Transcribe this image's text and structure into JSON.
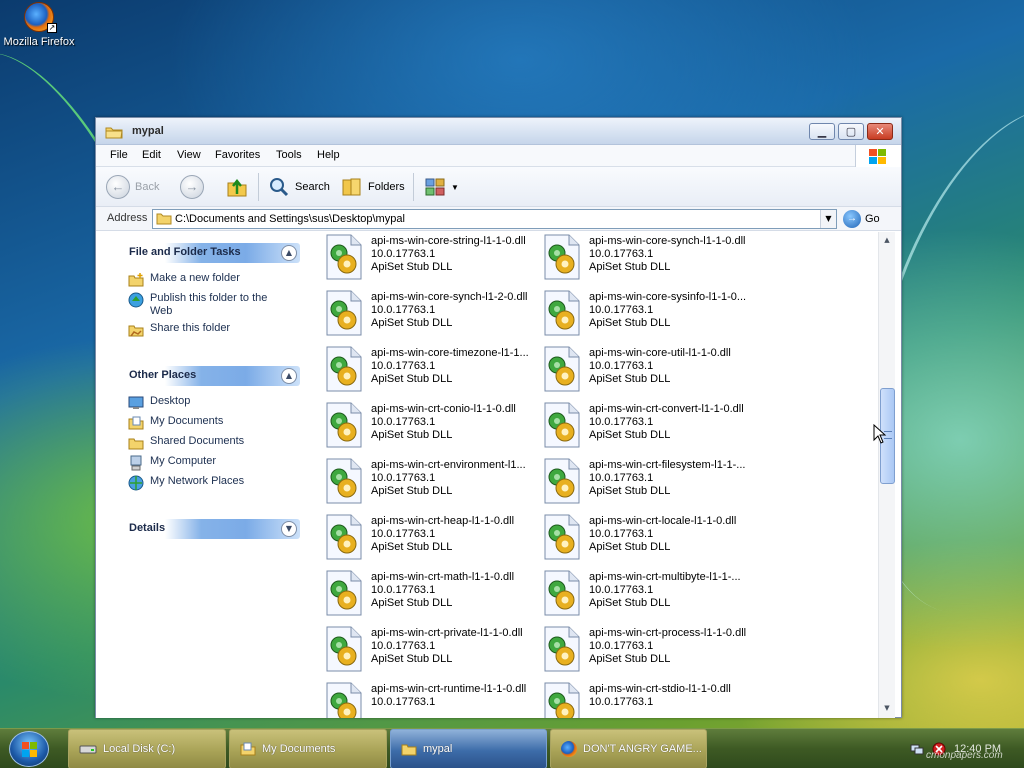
{
  "desktop": {
    "icons": [
      {
        "label": "Mozilla Firefox",
        "icon": "firefox-icon"
      }
    ],
    "watermark": "cmonpapers.com"
  },
  "window": {
    "title": "mypal",
    "controls": {
      "minimize": "minimize",
      "maximize": "maximize",
      "close": "close"
    },
    "menu": [
      "File",
      "Edit",
      "View",
      "Favorites",
      "Tools",
      "Help"
    ],
    "toolbar": {
      "back": "Back",
      "forward": "",
      "search": "Search",
      "folders": "Folders"
    },
    "address": {
      "label": "Address",
      "value": "C:\\Documents and Settings\\sus\\Desktop\\mypal",
      "go": "Go"
    },
    "taskpane": {
      "groups": [
        {
          "title": "File and Folder Tasks",
          "items": [
            {
              "label": "Make a new folder",
              "icon": "new-folder-icon"
            },
            {
              "label": "Publish this folder to the Web",
              "icon": "publish-web-icon"
            },
            {
              "label": "Share this folder",
              "icon": "share-folder-icon"
            }
          ]
        },
        {
          "title": "Other Places",
          "items": [
            {
              "label": "Desktop",
              "icon": "desktop-icon"
            },
            {
              "label": "My Documents",
              "icon": "my-documents-icon"
            },
            {
              "label": "Shared Documents",
              "icon": "shared-documents-icon"
            },
            {
              "label": "My Computer",
              "icon": "my-computer-icon"
            },
            {
              "label": "My Network Places",
              "icon": "network-places-icon"
            }
          ]
        },
        {
          "title": "Details",
          "items": []
        }
      ]
    },
    "files": [
      {
        "name": "api-ms-win-core-string-l1-1-0.dll",
        "version": "10.0.17763.1",
        "description": "ApiSet Stub DLL"
      },
      {
        "name": "api-ms-win-core-synch-l1-1-0.dll",
        "version": "10.0.17763.1",
        "description": "ApiSet Stub DLL"
      },
      {
        "name": "api-ms-win-core-synch-l1-2-0.dll",
        "version": "10.0.17763.1",
        "description": "ApiSet Stub DLL"
      },
      {
        "name": "api-ms-win-core-sysinfo-l1-1-0...",
        "version": "10.0.17763.1",
        "description": "ApiSet Stub DLL"
      },
      {
        "name": "api-ms-win-core-timezone-l1-1...",
        "version": "10.0.17763.1",
        "description": "ApiSet Stub DLL"
      },
      {
        "name": "api-ms-win-core-util-l1-1-0.dll",
        "version": "10.0.17763.1",
        "description": "ApiSet Stub DLL"
      },
      {
        "name": "api-ms-win-crt-conio-l1-1-0.dll",
        "version": "10.0.17763.1",
        "description": "ApiSet Stub DLL"
      },
      {
        "name": "api-ms-win-crt-convert-l1-1-0.dll",
        "version": "10.0.17763.1",
        "description": "ApiSet Stub DLL"
      },
      {
        "name": "api-ms-win-crt-environment-l1...",
        "version": "10.0.17763.1",
        "description": "ApiSet Stub DLL"
      },
      {
        "name": "api-ms-win-crt-filesystem-l1-1-...",
        "version": "10.0.17763.1",
        "description": "ApiSet Stub DLL"
      },
      {
        "name": "api-ms-win-crt-heap-l1-1-0.dll",
        "version": "10.0.17763.1",
        "description": "ApiSet Stub DLL"
      },
      {
        "name": "api-ms-win-crt-locale-l1-1-0.dll",
        "version": "10.0.17763.1",
        "description": "ApiSet Stub DLL"
      },
      {
        "name": "api-ms-win-crt-math-l1-1-0.dll",
        "version": "10.0.17763.1",
        "description": "ApiSet Stub DLL"
      },
      {
        "name": "api-ms-win-crt-multibyte-l1-1-...",
        "version": "10.0.17763.1",
        "description": "ApiSet Stub DLL"
      },
      {
        "name": "api-ms-win-crt-private-l1-1-0.dll",
        "version": "10.0.17763.1",
        "description": "ApiSet Stub DLL"
      },
      {
        "name": "api-ms-win-crt-process-l1-1-0.dll",
        "version": "10.0.17763.1",
        "description": "ApiSet Stub DLL"
      },
      {
        "name": "api-ms-win-crt-runtime-l1-1-0.dll",
        "version": "10.0.17763.1",
        "description": ""
      },
      {
        "name": "api-ms-win-crt-stdio-l1-1-0.dll",
        "version": "10.0.17763.1",
        "description": ""
      }
    ],
    "scrollbar": {
      "position_fraction": 0.32
    }
  },
  "taskbar": {
    "start": "start-orb",
    "buttons": [
      {
        "label": "Local Disk (C:)",
        "icon": "drive-icon",
        "active": false
      },
      {
        "label": "My Documents",
        "icon": "documents-folder-icon",
        "active": false
      },
      {
        "label": "mypal",
        "icon": "folder-icon",
        "active": true
      },
      {
        "label": "DON'T ANGRY GAME...",
        "icon": "firefox-icon",
        "active": false
      }
    ],
    "clock": "12:40 PM"
  },
  "colors": {
    "taskpane_header": "#5a96e1",
    "taskbar": "#3e5a24",
    "active_task": "#3d6ca9"
  }
}
